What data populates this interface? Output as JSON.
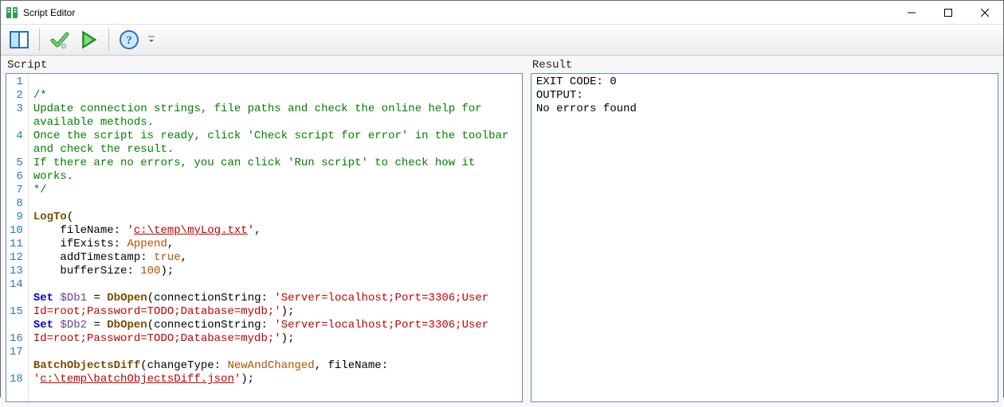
{
  "window": {
    "title": "Script Editor"
  },
  "toolbar": {
    "toggle_panels_tooltip": "Toggle panels",
    "check_tooltip": "Check script for error",
    "run_tooltip": "Run script",
    "help_tooltip": "Help"
  },
  "panels": {
    "script_label": "Script",
    "result_label": "Result"
  },
  "script": {
    "wrapped_lines": [
      {
        "n": "1",
        "html": ""
      },
      {
        "n": "2",
        "html": "<span class='c-comment'>/*</span>"
      },
      {
        "n": "3",
        "html": "<span class='c-comment'>Update connection strings, file paths and check the online help for available methods.</span>"
      },
      {
        "n": "4",
        "html": "<span class='c-comment'>Once the script is ready, click 'Check script for error' in the toolbar and check the result.</span>"
      },
      {
        "n": "5",
        "html": "<span class='c-comment'>If there are no errors, you can click 'Run script' to check how it works.</span>"
      },
      {
        "n": "6",
        "html": "<span class='c-comment'>*/</span>"
      },
      {
        "n": "7",
        "html": ""
      },
      {
        "n": "8",
        "html": "<span class='c-fn'>LogTo</span><span class='c-punct'>(</span>"
      },
      {
        "n": "9",
        "html": "    <span class='c-param'>fileName</span><span class='c-punct'>:</span> <span class='c-str'>'</span><span class='c-strlink'>c:\\temp\\myLog.txt</span><span class='c-str'>'</span><span class='c-punct'>,</span>"
      },
      {
        "n": "10",
        "html": "    <span class='c-param'>ifExists</span><span class='c-punct'>:</span> <span class='c-enum'>Append</span><span class='c-punct'>,</span>"
      },
      {
        "n": "11",
        "html": "    <span class='c-param'>addTimestamp</span><span class='c-punct'>:</span> <span class='c-enum'>true</span><span class='c-punct'>,</span>"
      },
      {
        "n": "12",
        "html": "    <span class='c-param'>bufferSize</span><span class='c-punct'>:</span> <span class='c-num'>100</span><span class='c-punct'>);</span>"
      },
      {
        "n": "13",
        "html": ""
      },
      {
        "n": "14",
        "html": "<span class='c-kw'>Set</span> <span class='c-var'>$Db1</span> <span class='c-punct'>=</span> <span class='c-fn'>DbOpen</span><span class='c-punct'>(</span><span class='c-param'>connectionString</span><span class='c-punct'>:</span> <span class='c-str'>'Server=localhost;Port=3306;User Id=root;Password=TODO;Database=mydb;'</span><span class='c-punct'>);</span>"
      },
      {
        "n": "15",
        "html": "<span class='c-kw'>Set</span> <span class='c-var'>$Db2</span> <span class='c-punct'>=</span> <span class='c-fn'>DbOpen</span><span class='c-punct'>(</span><span class='c-param'>connectionString</span><span class='c-punct'>:</span> <span class='c-str'>'Server=localhost;Port=3306;User Id=root;Password=TODO;Database=mydb;'</span><span class='c-punct'>);</span>"
      },
      {
        "n": "16",
        "html": ""
      },
      {
        "n": "17",
        "html": "<span class='c-fn'>BatchObjectsDiff</span><span class='c-punct'>(</span><span class='c-param'>changeType</span><span class='c-punct'>:</span> <span class='c-enum'>NewAndChanged</span><span class='c-punct'>,</span> <span class='c-param'>fileName</span><span class='c-punct'>:</span> <span class='c-str'>'</span><span class='c-strlink'>c:\\temp\\batchObjectsDiff.json</span><span class='c-str'>'</span><span class='c-punct'>);</span>"
      },
      {
        "n": "18",
        "html": ""
      }
    ]
  },
  "result": {
    "lines": [
      "EXIT CODE: 0",
      "OUTPUT:",
      "No errors found"
    ]
  }
}
